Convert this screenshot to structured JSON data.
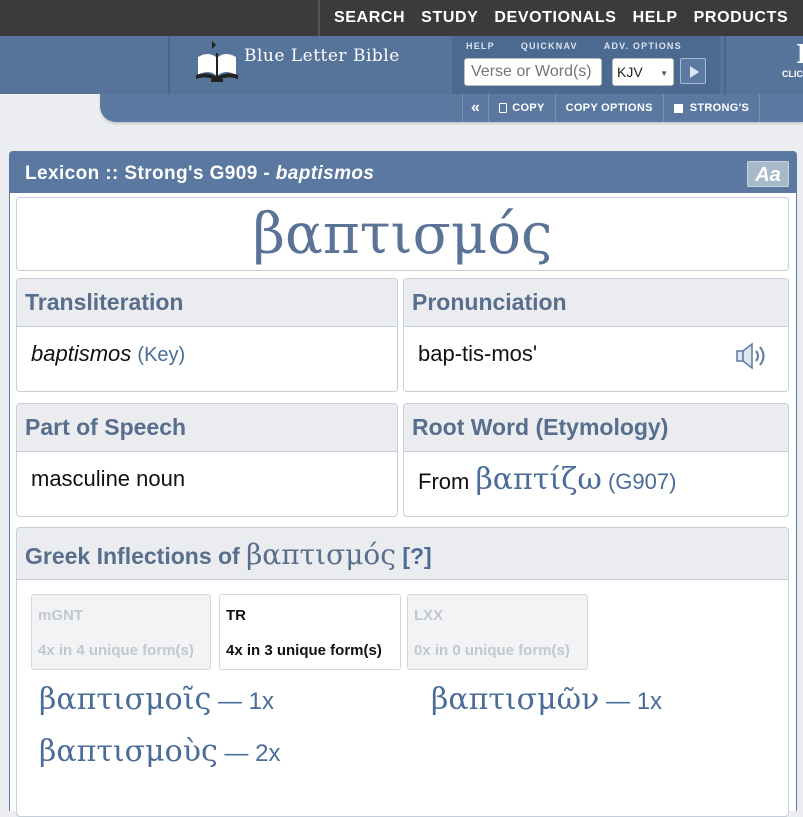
{
  "topnav": {
    "items": [
      "SEARCH",
      "STUDY",
      "DEVOTIONALS",
      "HELP",
      "PRODUCTS"
    ]
  },
  "header": {
    "logo_text": "Blue Letter Bible",
    "search_labels": [
      "HELP",
      "QUICKNAV",
      "ADV. OPTIONS"
    ],
    "search_placeholder": "Verse or Word(s)",
    "version": "KJV"
  },
  "toolbar": {
    "copy": "COPY",
    "copy_options": "COPY OPTIONS",
    "strongs": "STRONG'S"
  },
  "lexicon": {
    "title_prefix": "Lexicon :: Strong's G909 - ",
    "title_word": "baptismos",
    "font_button": "Aa",
    "lemma": "βαπτισμός",
    "transliteration": {
      "heading": "Transliteration",
      "value": "baptismos",
      "key": "(Key)"
    },
    "pronunciation": {
      "heading": "Pronunciation",
      "value": "bap-tis-mos'"
    },
    "part_of_speech": {
      "heading": "Part of Speech",
      "value": "masculine noun"
    },
    "root_word": {
      "heading": "Root Word (Etymology)",
      "prefix": "From",
      "greek": "βαπτίζω",
      "strongs": "(G907)"
    },
    "inflections": {
      "heading_prefix": "Greek Inflections of",
      "heading_greek": "βαπτισμός",
      "help": "[?]",
      "tabs": [
        {
          "name": "mGNT",
          "count": "4x in 4 unique form(s)"
        },
        {
          "name": "TR",
          "count": "4x in 3 unique form(s)"
        },
        {
          "name": "LXX",
          "count": "0x in 0 unique form(s)"
        }
      ],
      "forms": [
        {
          "word": "βαπτισμοῖς",
          "count": " — 1x"
        },
        {
          "word": "βαπτισμῶν",
          "count": " — 1x"
        },
        {
          "word": "βαπτισμοὺς",
          "count": " — 2x"
        }
      ]
    }
  }
}
